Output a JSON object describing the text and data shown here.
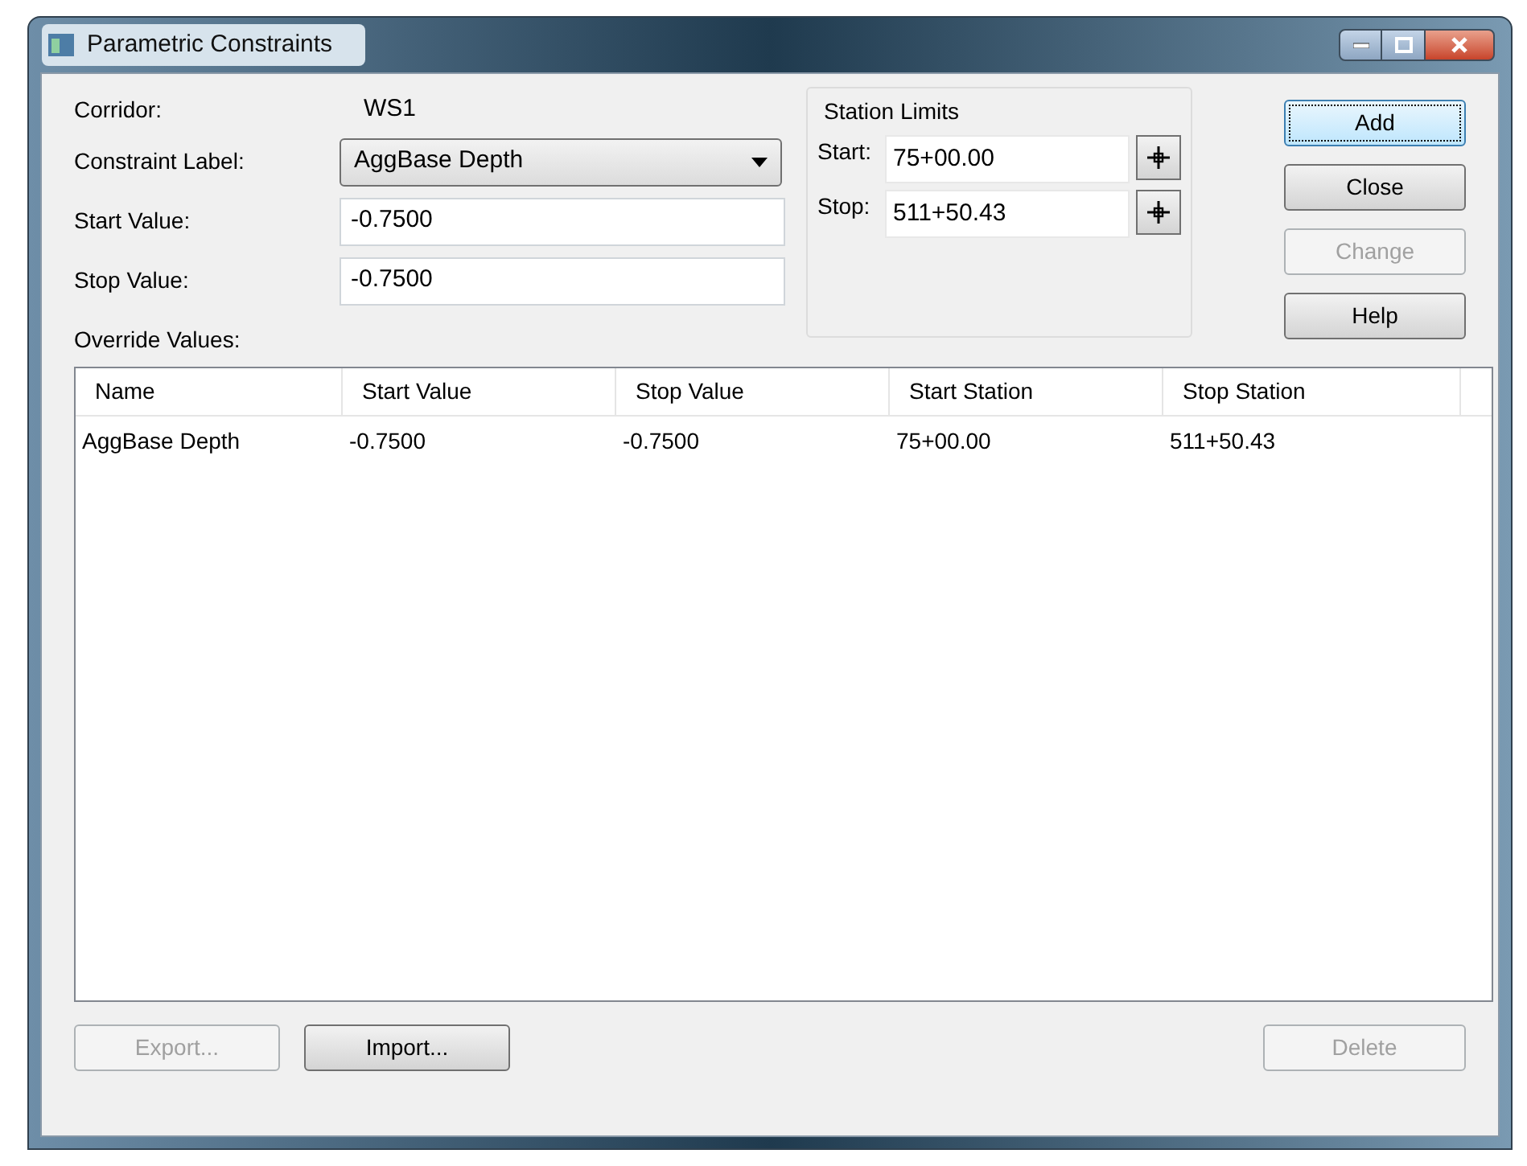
{
  "window": {
    "title": "Parametric Constraints"
  },
  "fields": [
    {
      "label": "Corridor:",
      "kind": "text",
      "value": "WS1"
    },
    {
      "label": "Constraint Label:",
      "kind": "dropdown",
      "value": "AggBase Depth"
    },
    {
      "label": "Start Value:",
      "kind": "input",
      "value": "-0.7500"
    },
    {
      "label": "Stop Value:",
      "kind": "input",
      "value": "-0.7500"
    }
  ],
  "station_limits": {
    "title": "Station Limits",
    "fields": [
      {
        "label": "Start:",
        "value": "75+00.00"
      },
      {
        "label": "Stop:",
        "value": "511+50.43"
      }
    ]
  },
  "side_buttons": [
    {
      "label": "Add",
      "disabled": false,
      "default": true
    },
    {
      "label": "Close",
      "disabled": false,
      "default": false
    },
    {
      "label": "Change",
      "disabled": true,
      "default": false
    },
    {
      "label": "Help",
      "disabled": false,
      "default": false
    }
  ],
  "table": {
    "title": "Override Values:",
    "columns": [
      "Name",
      "Start Value",
      "Stop Value",
      "Start Station",
      "Stop Station"
    ],
    "rows": [
      [
        "AggBase Depth",
        "-0.7500",
        "-0.7500",
        "75+00.00",
        "511+50.43"
      ]
    ]
  },
  "bottom_left_buttons": [
    {
      "label": "Export...",
      "disabled": true
    },
    {
      "label": "Import...",
      "disabled": false
    }
  ],
  "bottom_right_buttons": [
    {
      "label": "Delete",
      "disabled": true
    }
  ]
}
